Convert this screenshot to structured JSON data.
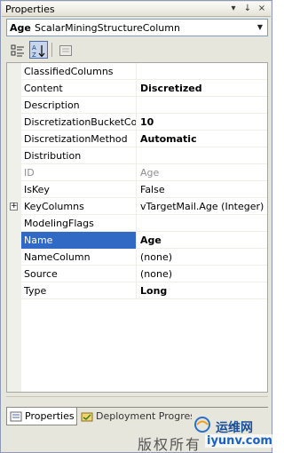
{
  "window": {
    "title": "Properties",
    "title_buttons": [
      "▾",
      "↓",
      "×"
    ]
  },
  "selector": {
    "object_name": "Age",
    "object_type": "ScalarMiningStructureColumn"
  },
  "properties": [
    {
      "name": "ClassifiedColumns",
      "value": "",
      "bold": false
    },
    {
      "name": "Content",
      "value": "Discretized",
      "bold": true
    },
    {
      "name": "Description",
      "value": "",
      "bold": false
    },
    {
      "name": "DiscretizationBucketCo",
      "value": "10",
      "bold": true
    },
    {
      "name": "DiscretizationMethod",
      "value": "Automatic",
      "bold": true
    },
    {
      "name": "Distribution",
      "value": "",
      "bold": false
    },
    {
      "name": "ID",
      "value": "Age",
      "bold": false,
      "disabled": true
    },
    {
      "name": "IsKey",
      "value": "False",
      "bold": false
    },
    {
      "name": "KeyColumns",
      "value": "vTargetMail.Age (Integer)",
      "bold": false,
      "expandable": true
    },
    {
      "name": "ModelingFlags",
      "value": "",
      "bold": false
    },
    {
      "name": "Name",
      "value": "Age",
      "bold": true,
      "selected": true
    },
    {
      "name": "NameColumn",
      "value": "(none)",
      "bold": false
    },
    {
      "name": "Source",
      "value": "(none)",
      "bold": false
    },
    {
      "name": "Type",
      "value": "Long",
      "bold": true
    }
  ],
  "tabs": [
    {
      "label": "Properties",
      "active": true
    },
    {
      "label": "Deployment Progress",
      "active": false
    }
  ],
  "watermark": {
    "brand": "运维网",
    "copyright": "版权所有",
    "url": "iyunv.com"
  },
  "colors": {
    "selection": "#316ac5",
    "panel": "#e6e6dc",
    "border": "#7f9db9"
  }
}
